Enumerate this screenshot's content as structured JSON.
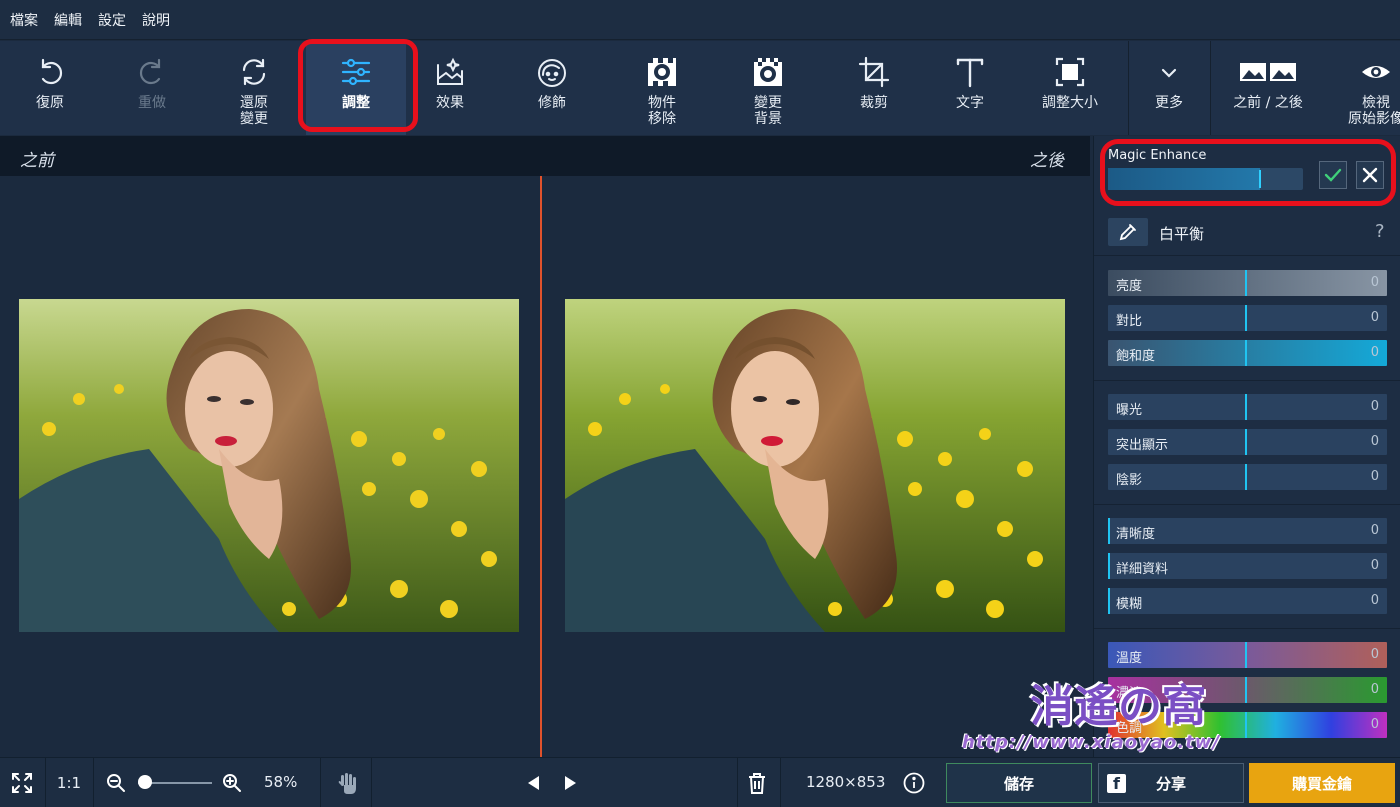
{
  "menu": [
    "檔案",
    "編輯",
    "設定",
    "說明"
  ],
  "toolbar": {
    "undo": "復原",
    "redo": "重做",
    "revert": "還原\n變更",
    "adjust": "調整",
    "effects": "效果",
    "retouch": "修飾",
    "object_removal": "物件\n移除",
    "change_background": "變更\n背景",
    "crop": "裁剪",
    "text": "文字",
    "resize": "調整大小",
    "more": "更多",
    "before_after": "之前 / 之後",
    "view_original": "檢視\n原始影像"
  },
  "compare": {
    "before": "之前",
    "after": "之後"
  },
  "panel": {
    "magic_enhance": {
      "label": "Magic Enhance",
      "value_fraction": 0.78
    },
    "white_balance": "白平衡",
    "help": "?",
    "sliders": [
      {
        "name": "亮度",
        "value": "0",
        "knob": 0.49
      },
      {
        "name": "對比",
        "value": "0",
        "knob": 0.49
      },
      {
        "name": "飽和度",
        "value": "0",
        "knob": 0.49
      },
      {
        "name": "曝光",
        "value": "0",
        "knob": 0.49
      },
      {
        "name": "突出顯示",
        "value": "0",
        "knob": 0.49
      },
      {
        "name": "陰影",
        "value": "0",
        "knob": 0.49
      },
      {
        "name": "清晰度",
        "value": "0",
        "knob": 0.0
      },
      {
        "name": "詳細資料",
        "value": "0",
        "knob": 0.0
      },
      {
        "name": "模糊",
        "value": "0",
        "knob": 0.0
      },
      {
        "name": "溫度",
        "value": "0",
        "knob": 0.49
      },
      {
        "name": "濃淡",
        "value": "0",
        "knob": 0.49
      },
      {
        "name": "色調",
        "value": "0",
        "knob": 0.49
      }
    ]
  },
  "status": {
    "ratio": "1:1",
    "zoom": "58%",
    "zoom_fraction": 0.1,
    "dimensions": "1280×853",
    "save": "儲存",
    "share": "分享",
    "buy": "購買金鑰"
  },
  "watermark": {
    "chars": "消遙の窩",
    "url": "http://www.xiaoyao.tw/"
  },
  "colors": {
    "accent": "#2fb4ff",
    "highlight": "#e8101c",
    "buy": "#e8a410",
    "divider": "#e0522c"
  }
}
